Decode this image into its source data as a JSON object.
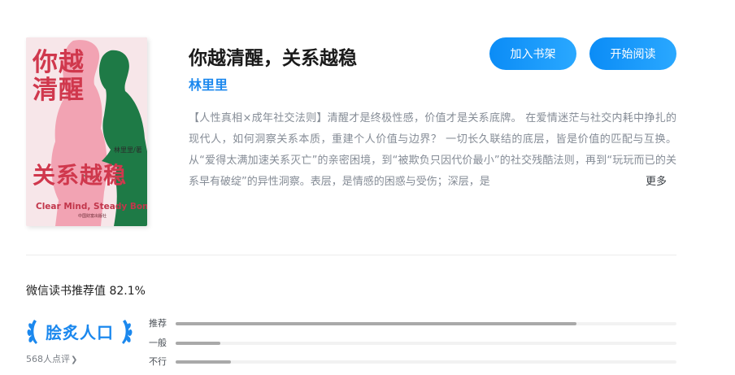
{
  "book": {
    "cover": {
      "title_line1": "你越清醒",
      "title_line2": "关系越稳",
      "subtitle": "Clear Mind, Steady Bond",
      "author": "林里里/著",
      "publisher": "中国财富出版社"
    },
    "title": "你越清醒，关系越稳",
    "author": "林里里",
    "intro": "【人性真相×成年社交法则】清醒才是终极性感，价值才是关系底牌。 在爱情迷茫与社交内耗中挣扎的现代人，如何洞察关系本质，重建个人价值与边界？ 一切长久联结的底层，皆是价值的匹配与互换。从“爱得太满加速关系灭亡”的亲密困境，到“被欺负只因代价最小”的社交残酷法则，再到“玩玩而已的关系早有破绽”的异性洞察。表层，是情感的困惑与受伤；深层，是",
    "more_label": "更多"
  },
  "actions": {
    "add_shelf": "加入书架",
    "start_read": "开始阅读"
  },
  "rating": {
    "label": "微信读书推荐值 82.1%",
    "badge_text": "脍炙人口",
    "reviews": "568人点评",
    "rows": [
      {
        "label": "推荐",
        "value": 0.8
      },
      {
        "label": "一般",
        "value": 0.09
      },
      {
        "label": "不行",
        "value": 0.11
      }
    ]
  },
  "colors": {
    "accent": "#1b88ee",
    "button": "#0b8cf6",
    "cover_pink": "#f2a3b3",
    "cover_green": "#1e7a46",
    "cover_red": "#d0384d",
    "bar_fill": "#a9a9a9"
  },
  "icons": {
    "badge": "laurel-wreath-icon",
    "reviews_chevron": "chevron-right-icon"
  }
}
